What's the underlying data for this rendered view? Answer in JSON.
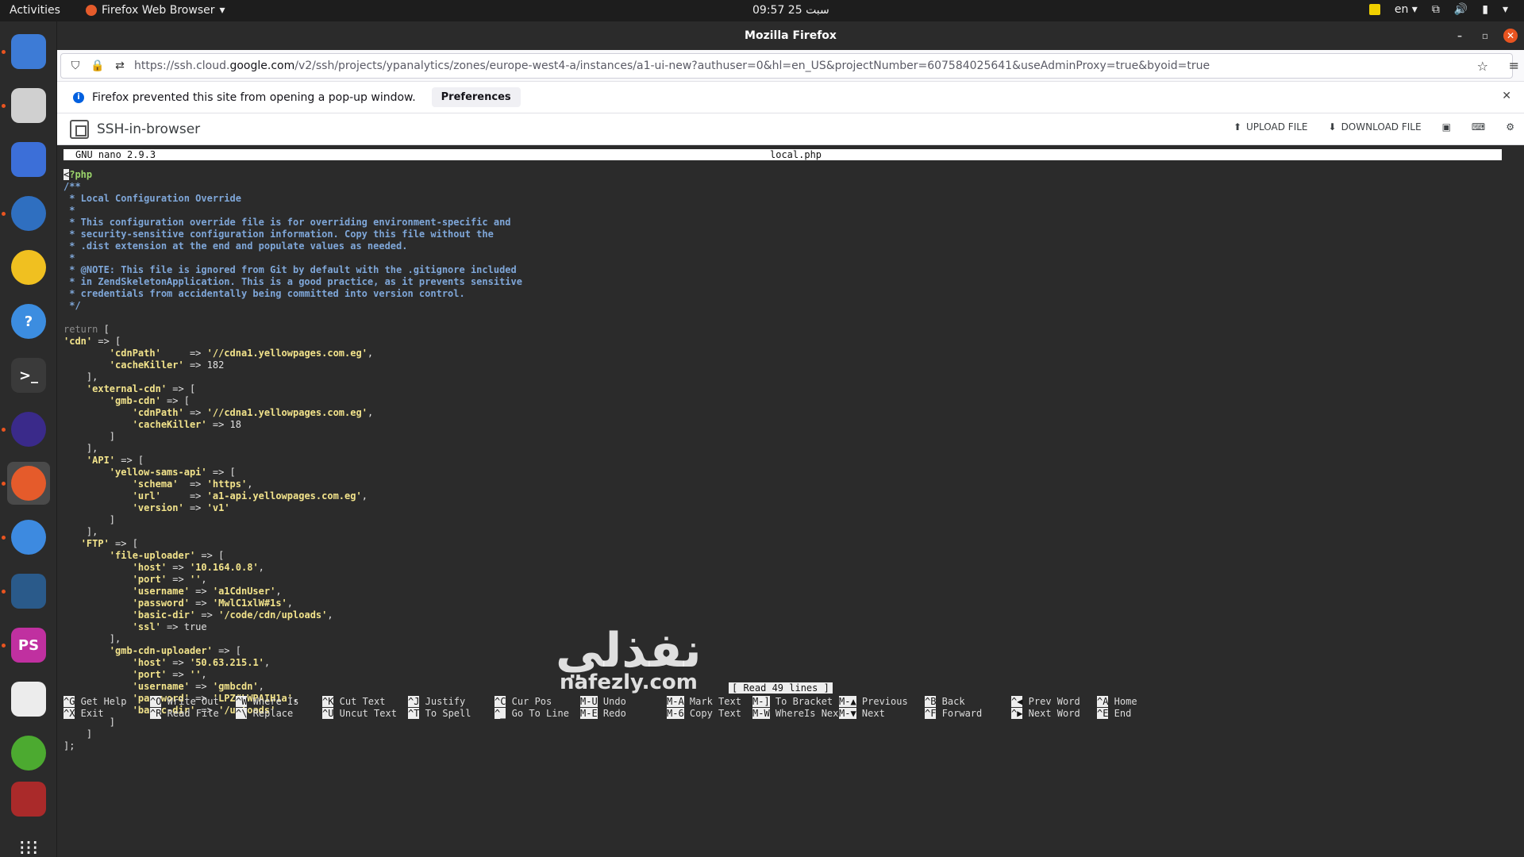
{
  "topbar": {
    "activities": "Activities",
    "app_menu": "Firefox Web Browser",
    "clock": "09:57  25 سبت",
    "lang": "en"
  },
  "dock": {
    "items": [
      {
        "name": "software-updater",
        "color": "#3d7bd6"
      },
      {
        "name": "files",
        "color": "#d0d0d0"
      },
      {
        "name": "screenshot",
        "color": "#3c6fd8"
      },
      {
        "name": "thunderbird",
        "color": "#2f6fc0"
      },
      {
        "name": "rhythmbox",
        "color": "#f0c020"
      },
      {
        "name": "help",
        "color": "#3c8de0"
      },
      {
        "name": "terminal",
        "color": "#3a3a3a"
      },
      {
        "name": "eclipse",
        "color": "#3a2a8a"
      },
      {
        "name": "firefox",
        "color": "#e55b2b"
      },
      {
        "name": "chrome",
        "color": "#3d8ae0"
      },
      {
        "name": "mysql-workbench",
        "color": "#2a5a8a"
      },
      {
        "name": "phpstorm",
        "color": "#c030a0"
      },
      {
        "name": "text-editor",
        "color": "#ececec"
      },
      {
        "name": "green-app",
        "color": "#4caa30"
      },
      {
        "name": "red-app",
        "color": "#aa2a2a"
      }
    ],
    "show_apps": "show-apps"
  },
  "window": {
    "title": "Mozilla Firefox"
  },
  "browser": {
    "url_prefix": "https://ssh.cloud.",
    "url_domain": "google.com",
    "url_suffix": "/v2/ssh/projects/ypanalytics/zones/europe-west4-a/instances/a1-ui-new?authuser=0&hl=en_US&projectNumber=607584025641&useAdminProxy=true&byoid=true",
    "notification": "Firefox prevented this site from opening a pop-up window.",
    "preferences_label": "Preferences"
  },
  "ssh": {
    "title": "SSH-in-browser",
    "upload": "UPLOAD FILE",
    "download": "DOWNLOAD FILE"
  },
  "nano": {
    "version": "GNU nano 2.9.3",
    "filename": "local.php",
    "status": "[ Read 49 lines ]",
    "shortcuts": [
      {
        "k1": "^G",
        "l1": "Get Help",
        "k2": "^X",
        "l2": "Exit"
      },
      {
        "k1": "^O",
        "l1": "Write Out",
        "k2": "^R",
        "l2": "Read File"
      },
      {
        "k1": "^W",
        "l1": "Where Is",
        "k2": "^\\",
        "l2": "Replace"
      },
      {
        "k1": "^K",
        "l1": "Cut Text",
        "k2": "^U",
        "l2": "Uncut Text"
      },
      {
        "k1": "^J",
        "l1": "Justify",
        "k2": "^T",
        "l2": "To Spell"
      },
      {
        "k1": "^C",
        "l1": "Cur Pos",
        "k2": "^_",
        "l2": "Go To Line"
      },
      {
        "k1": "M-U",
        "l1": "Undo",
        "k2": "M-E",
        "l2": "Redo"
      },
      {
        "k1": "M-A",
        "l1": "Mark Text",
        "k2": "M-6",
        "l2": "Copy Text"
      },
      {
        "k1": "M-]",
        "l1": "To Bracket",
        "k2": "M-W",
        "l2": "WhereIs Next"
      },
      {
        "k1": "M-▲",
        "l1": "Previous",
        "k2": "M-▼",
        "l2": "Next"
      },
      {
        "k1": "^B",
        "l1": "Back",
        "k2": "^F",
        "l2": "Forward"
      },
      {
        "k1": "^◀",
        "l1": "Prev Word",
        "k2": "^▶",
        "l2": "Next Word"
      },
      {
        "k1": "^A",
        "l1": "Home",
        "k2": "^E",
        "l2": "End"
      }
    ]
  },
  "code_lines": [
    [
      [
        "cur",
        "<"
      ],
      [
        "t",
        "?php"
      ]
    ],
    [
      [
        "c",
        "/**"
      ]
    ],
    [
      [
        "c",
        " * Local Configuration Override"
      ]
    ],
    [
      [
        "c",
        " *"
      ]
    ],
    [
      [
        "c",
        " * This configuration override file is for overriding environment-specific and"
      ]
    ],
    [
      [
        "c",
        " * security-sensitive configuration information. Copy this file without the"
      ]
    ],
    [
      [
        "c",
        " * .dist extension at the end and populate values as needed."
      ]
    ],
    [
      [
        "c",
        " *"
      ]
    ],
    [
      [
        "c",
        " * @NOTE: This file is ignored from Git by default with the .gitignore included"
      ]
    ],
    [
      [
        "c",
        " * in ZendSkeletonApplication. This is a good practice, as it prevents sensitive"
      ]
    ],
    [
      [
        "c",
        " * credentials from accidentally being committed into version control."
      ]
    ],
    [
      [
        "c",
        " */"
      ]
    ],
    [
      [
        "w",
        ""
      ]
    ],
    [
      [
        "k",
        "return"
      ],
      [
        "w",
        " ["
      ]
    ],
    [
      [
        "s",
        "'cdn'"
      ],
      [
        "w",
        " => ["
      ]
    ],
    [
      [
        "w",
        "        "
      ],
      [
        "s",
        "'cdnPath'"
      ],
      [
        "w",
        "     => "
      ],
      [
        "s",
        "'//cdna1.yellowpages.com.eg'"
      ],
      [
        "w",
        ","
      ]
    ],
    [
      [
        "w",
        "        "
      ],
      [
        "s",
        "'cacheKiller'"
      ],
      [
        "w",
        " => 182"
      ]
    ],
    [
      [
        "w",
        "    ],"
      ]
    ],
    [
      [
        "w",
        "    "
      ],
      [
        "s",
        "'external-cdn'"
      ],
      [
        "w",
        " => ["
      ]
    ],
    [
      [
        "w",
        "        "
      ],
      [
        "s",
        "'gmb-cdn'"
      ],
      [
        "w",
        " => ["
      ]
    ],
    [
      [
        "w",
        "            "
      ],
      [
        "s",
        "'cdnPath'"
      ],
      [
        "w",
        " => "
      ],
      [
        "s",
        "'//cdna1.yellowpages.com.eg'"
      ],
      [
        "w",
        ","
      ]
    ],
    [
      [
        "w",
        "            "
      ],
      [
        "s",
        "'cacheKiller'"
      ],
      [
        "w",
        " => 18"
      ]
    ],
    [
      [
        "w",
        "        ]"
      ]
    ],
    [
      [
        "w",
        "    ],"
      ]
    ],
    [
      [
        "w",
        "    "
      ],
      [
        "s",
        "'API'"
      ],
      [
        "w",
        " => ["
      ]
    ],
    [
      [
        "w",
        "        "
      ],
      [
        "s",
        "'yellow-sams-api'"
      ],
      [
        "w",
        " => ["
      ]
    ],
    [
      [
        "w",
        "            "
      ],
      [
        "s",
        "'schema'"
      ],
      [
        "w",
        "  => "
      ],
      [
        "s",
        "'https'"
      ],
      [
        "w",
        ","
      ]
    ],
    [
      [
        "w",
        "            "
      ],
      [
        "s",
        "'url'"
      ],
      [
        "w",
        "     => "
      ],
      [
        "s",
        "'a1-api.yellowpages.com.eg'"
      ],
      [
        "w",
        ","
      ]
    ],
    [
      [
        "w",
        "            "
      ],
      [
        "s",
        "'version'"
      ],
      [
        "w",
        " => "
      ],
      [
        "s",
        "'v1'"
      ]
    ],
    [
      [
        "w",
        "        ]"
      ]
    ],
    [
      [
        "w",
        "    ],"
      ]
    ],
    [
      [
        "w",
        "   "
      ],
      [
        "s",
        "'FTP'"
      ],
      [
        "w",
        " => ["
      ]
    ],
    [
      [
        "w",
        "        "
      ],
      [
        "s",
        "'file-uploader'"
      ],
      [
        "w",
        " => ["
      ]
    ],
    [
      [
        "w",
        "            "
      ],
      [
        "s",
        "'host'"
      ],
      [
        "w",
        " => "
      ],
      [
        "s",
        "'10.164.0.8'"
      ],
      [
        "w",
        ","
      ]
    ],
    [
      [
        "w",
        "            "
      ],
      [
        "s",
        "'port'"
      ],
      [
        "w",
        " => "
      ],
      [
        "s",
        "''"
      ],
      [
        "w",
        ","
      ]
    ],
    [
      [
        "w",
        "            "
      ],
      [
        "s",
        "'username'"
      ],
      [
        "w",
        " => "
      ],
      [
        "s",
        "'a1CdnUser'"
      ],
      [
        "w",
        ","
      ]
    ],
    [
      [
        "w",
        "            "
      ],
      [
        "s",
        "'password'"
      ],
      [
        "w",
        " => "
      ],
      [
        "s",
        "'MwlC1xlW#1s'"
      ],
      [
        "w",
        ","
      ]
    ],
    [
      [
        "w",
        "            "
      ],
      [
        "s",
        "'basic-dir'"
      ],
      [
        "w",
        " => "
      ],
      [
        "s",
        "'/code/cdn/uploads'"
      ],
      [
        "w",
        ","
      ]
    ],
    [
      [
        "w",
        "            "
      ],
      [
        "s",
        "'ssl'"
      ],
      [
        "w",
        " => true"
      ]
    ],
    [
      [
        "w",
        "        ],"
      ]
    ],
    [
      [
        "w",
        "        "
      ],
      [
        "s",
        "'gmb-cdn-uploader'"
      ],
      [
        "w",
        " => ["
      ]
    ],
    [
      [
        "w",
        "            "
      ],
      [
        "s",
        "'host'"
      ],
      [
        "w",
        " => "
      ],
      [
        "s",
        "'50.63.215.1'"
      ],
      [
        "w",
        ","
      ]
    ],
    [
      [
        "w",
        "            "
      ],
      [
        "s",
        "'port'"
      ],
      [
        "w",
        " => "
      ],
      [
        "s",
        "''"
      ],
      [
        "w",
        ","
      ]
    ],
    [
      [
        "w",
        "            "
      ],
      [
        "s",
        "'username'"
      ],
      [
        "w",
        " => "
      ],
      [
        "s",
        "'gmbcdn'"
      ],
      [
        "w",
        ","
      ]
    ],
    [
      [
        "w",
        "            "
      ],
      [
        "s",
        "'password'"
      ],
      [
        "w",
        " => "
      ],
      [
        "s",
        "'LPZ#LWPAIH1a'"
      ],
      [
        "w",
        ","
      ]
    ],
    [
      [
        "w",
        "            "
      ],
      [
        "s",
        "'basic-dir'"
      ],
      [
        "w",
        " => "
      ],
      [
        "s",
        "'/uploads'"
      ]
    ],
    [
      [
        "w",
        "        ]"
      ]
    ],
    [
      [
        "w",
        "    ]"
      ]
    ],
    [
      [
        "w",
        "];"
      ]
    ]
  ],
  "watermark": {
    "text": "نفذلي",
    "sub": "nafezly.com"
  }
}
